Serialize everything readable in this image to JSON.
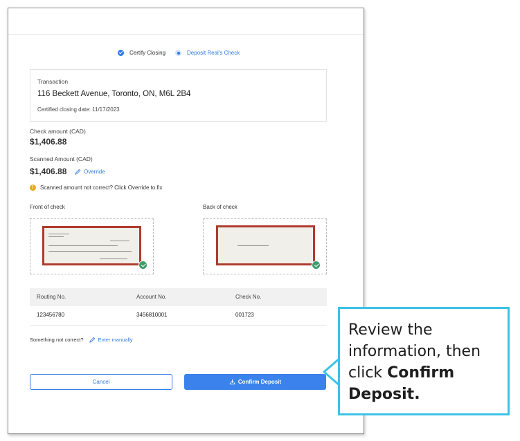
{
  "stepper": {
    "steps": [
      {
        "label": "Certify Closing",
        "state": "done"
      },
      {
        "label": "Deposit Real's Check",
        "state": "current"
      }
    ]
  },
  "transaction": {
    "label": "Transaction",
    "address": "116 Beckett Avenue, Toronto, ON, M6L 2B4",
    "closing_date": "Certified closing date: 11/17/2023"
  },
  "check_amount": {
    "label": "Check amount (CAD)",
    "value": "$1,406.88"
  },
  "scanned_amount": {
    "label": "Scanned Amount (CAD)",
    "value": "$1,406.88",
    "override_label": "Override"
  },
  "warning": {
    "icon": "!",
    "text": "Scanned amount not correct? Click Override to fix"
  },
  "front_check": {
    "label": "Front of check"
  },
  "back_check": {
    "label": "Back of check"
  },
  "table": {
    "headers": [
      "Routing No.",
      "Account No.",
      "Check No."
    ],
    "values": [
      "123456780",
      "3456810001",
      "001723"
    ]
  },
  "manual": {
    "prompt": "Something not correct?",
    "link": "Enter manually"
  },
  "buttons": {
    "cancel": "Cancel",
    "confirm": "Confirm Deposit"
  },
  "callout": {
    "text_before": "Review the information, then click ",
    "bold": "Confirm Deposit."
  },
  "colors": {
    "accent": "#2f7ae5",
    "success": "#3d9b6c",
    "warning": "#e6a71c",
    "callout_border": "#3cc2e6"
  }
}
